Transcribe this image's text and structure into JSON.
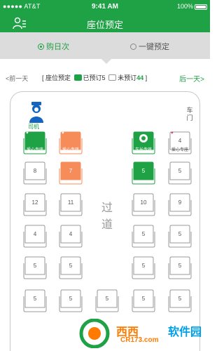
{
  "status_bar": {
    "carrier": "●●●●● AT&T",
    "time": "9:41 AM",
    "battery": "100%"
  },
  "header": {
    "title": "座位预定"
  },
  "tabs": [
    {
      "label": "购日次",
      "selected": true
    },
    {
      "label": "一键预定",
      "selected": false
    }
  ],
  "day_nav": {
    "prev": "<前一天",
    "next": "后一天>",
    "legend_title": "[ 座位预定",
    "booked_label": "已预订5",
    "unbooked_label": "未预订",
    "unbooked_count": "44",
    "legend_close": "]"
  },
  "bus": {
    "driver_label": "司机",
    "door_label": "车\n门",
    "aisle_label": "过\n道"
  },
  "seat_types": {
    "love": "爱心专座",
    "leader": "车长专座"
  },
  "seats": [
    {
      "number": "",
      "status": "booked",
      "label": "爱心专座",
      "heart": true
    },
    {
      "number": "",
      "status": "orange",
      "label": "爱心专座",
      "heart": true
    },
    {
      "number": "",
      "status": "booked",
      "label": "车长专座",
      "heart": false
    },
    {
      "number": "4",
      "status": "love-empty",
      "label": "爱心专座",
      "heart": true
    },
    {
      "number": "8",
      "status": "empty",
      "label": "",
      "heart": false
    },
    {
      "number": "7",
      "status": "orange",
      "label": "",
      "heart": false
    },
    {
      "number": "5",
      "status": "booked",
      "label": "",
      "heart": false
    },
    {
      "number": "5",
      "status": "empty",
      "label": "",
      "heart": false
    },
    {
      "number": "12",
      "status": "empty",
      "label": "",
      "heart": false
    },
    {
      "number": "11",
      "status": "empty",
      "label": "",
      "heart": false
    },
    {
      "number": "10",
      "status": "empty",
      "label": "",
      "heart": false
    },
    {
      "number": "9",
      "status": "empty",
      "label": "",
      "heart": false
    },
    {
      "number": "4",
      "status": "empty",
      "label": "",
      "heart": false
    },
    {
      "number": "4",
      "status": "empty",
      "label": "",
      "heart": false
    },
    {
      "number": "5",
      "status": "empty",
      "label": "",
      "heart": false
    },
    {
      "number": "5",
      "status": "empty",
      "label": "",
      "heart": false
    },
    {
      "number": "5",
      "status": "empty",
      "label": "",
      "heart": false
    },
    {
      "number": "5",
      "status": "empty",
      "label": "",
      "heart": false
    },
    {
      "number": "5",
      "status": "empty",
      "label": "",
      "heart": false
    },
    {
      "number": "5",
      "status": "empty",
      "label": "",
      "heart": false
    },
    {
      "number": "5",
      "status": "empty",
      "label": "",
      "heart": false
    },
    {
      "number": "5",
      "status": "empty",
      "label": "",
      "heart": false
    },
    {
      "number": "5",
      "status": "empty",
      "label": "",
      "heart": false
    },
    {
      "number": "5",
      "status": "empty",
      "label": "",
      "heart": false
    },
    {
      "number": "5",
      "status": "empty",
      "label": "",
      "heart": false
    }
  ],
  "colors": {
    "accent": "#1fa145",
    "orange": "#f58c5a",
    "seat_border": "#999999"
  },
  "watermark": {
    "brand": "西西",
    "site": "软件园",
    "url": "CR173.com"
  }
}
